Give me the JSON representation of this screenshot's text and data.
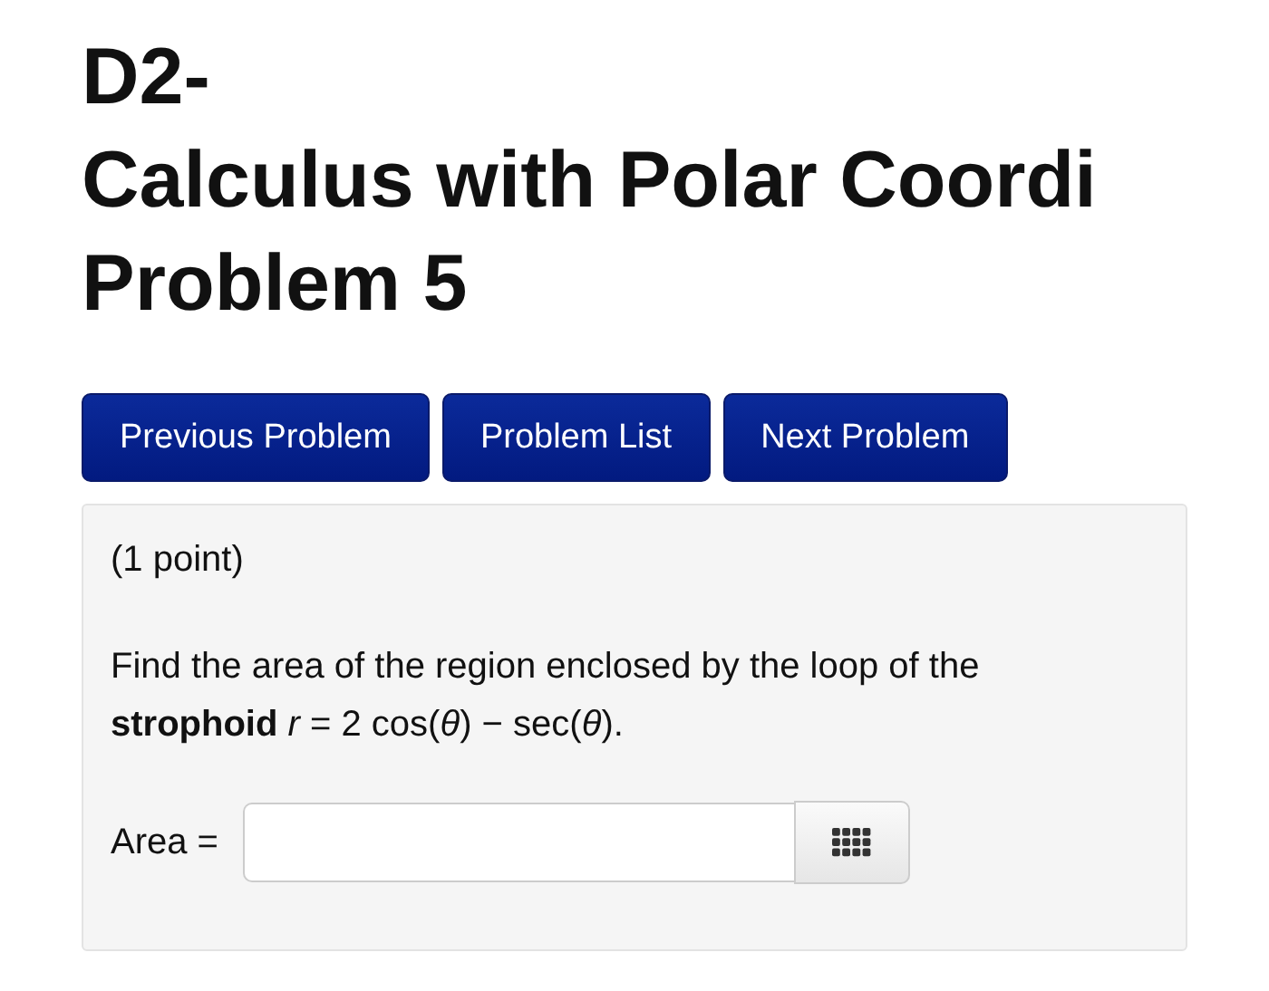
{
  "title_lines": [
    "D2-",
    "Calculus with Polar Coordi",
    "Problem 5"
  ],
  "nav_buttons": [
    "Previous Problem",
    "Problem List",
    "Next Problem"
  ],
  "problem": {
    "points": "(1 point)",
    "statement": "Find the area of the region enclosed by the loop of the **strophoid** *r* = 2 cos(*θ*) − sec(*θ*).",
    "answer": {
      "label": "Area ="
    }
  }
}
